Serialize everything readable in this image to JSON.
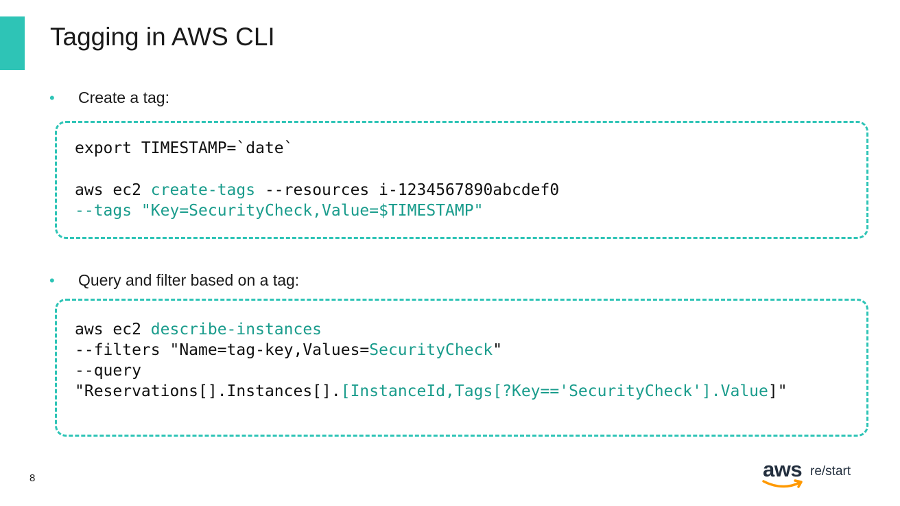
{
  "slide": {
    "title": "Tagging in AWS CLI",
    "page_number": "8",
    "accent_color": "#2ec4b6",
    "code_highlight_color": "#1a9c8c"
  },
  "bullets": [
    {
      "text": "Create a tag:"
    },
    {
      "text": "Query and filter based on a tag:"
    }
  ],
  "bullet_glyph": "•",
  "code_block_1": {
    "line1": "export TIMESTAMP=`date`",
    "line2_a": "aws ec2 ",
    "line2_b": "create-tags",
    "line2_c": " --resources i-1234567890abcdef0",
    "line3": "--tags \"Key=SecurityCheck,Value=$TIMESTAMP\""
  },
  "code_block_2": {
    "line1_a": "aws ec2 ",
    "line1_b": "describe-instances",
    "line2_a": "--filters \"Name=tag-key,Values=",
    "line2_b": "SecurityCheck",
    "line2_c": "\"",
    "line3": "--query",
    "line4_a": "\"Reservations[].Instances[].",
    "line4_b": "[InstanceId,Tags[?Key=='SecurityCheck'].Value",
    "line4_c": "]\""
  },
  "logo": {
    "brand": "aws",
    "product": "re/start",
    "icon": "aws-smile-arrow-icon",
    "arrow_color": "#ff9900",
    "text_color": "#232f3e"
  }
}
